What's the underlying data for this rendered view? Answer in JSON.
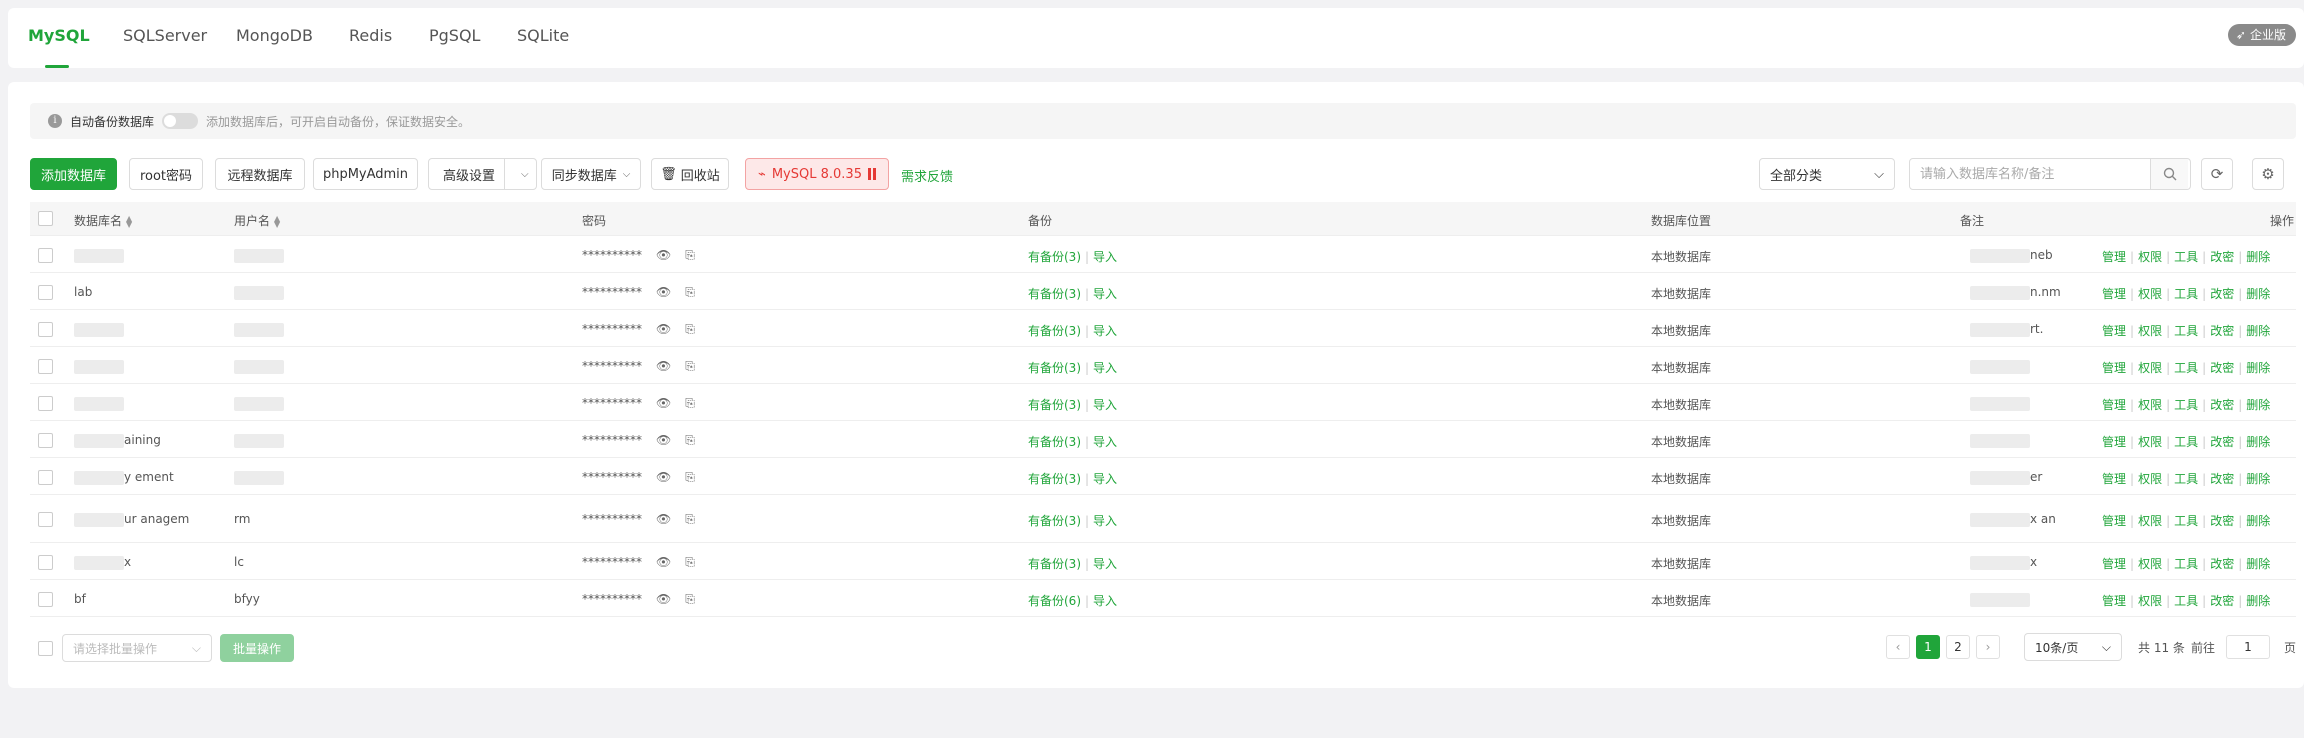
{
  "tabs": [
    "MySQL",
    "SQLServer",
    "MongoDB",
    "Redis",
    "PgSQL",
    "SQLite"
  ],
  "enterprise_badge": "企业版",
  "notice": {
    "label": "自动备份数据库",
    "hint": "添加数据库后，可开启自动备份，保证数据安全。"
  },
  "toolbar": {
    "add_db": "添加数据库",
    "root_password": "root密码",
    "remote_db": "远程数据库",
    "phpmyadmin": "phpMyAdmin",
    "advanced": "高级设置",
    "sync_db": "同步数据库",
    "recycle_bin": "回收站",
    "mysql_version": "MySQL 8.0.35",
    "feedback": "需求反馈",
    "category": "全部分类",
    "search_placeholder": "请输入数据库名称/备注"
  },
  "table": {
    "headers": {
      "db_name": "数据库名",
      "username": "用户名",
      "password": "密码",
      "backup": "备份",
      "location": "数据库位置",
      "note": "备注",
      "actions": "操作"
    },
    "rows": [
      {
        "db_name": "",
        "username": "",
        "password": "**********",
        "backup": "有备份(3)",
        "import": "导入",
        "location": "本地数据库",
        "note": "neb"
      },
      {
        "db_name": "lab",
        "username": "",
        "password": "**********",
        "backup": "有备份(3)",
        "import": "导入",
        "location": "本地数据库",
        "note": "n.nm"
      },
      {
        "db_name": "",
        "username": "",
        "password": "**********",
        "backup": "有备份(3)",
        "import": "导入",
        "location": "本地数据库",
        "note": "rt."
      },
      {
        "db_name": "",
        "username": "",
        "password": "**********",
        "backup": "有备份(3)",
        "import": "导入",
        "location": "本地数据库",
        "note": ""
      },
      {
        "db_name": "",
        "username": "",
        "password": "**********",
        "backup": "有备份(3)",
        "import": "导入",
        "location": "本地数据库",
        "note": ""
      },
      {
        "db_name": "aining",
        "username": "",
        "password": "**********",
        "backup": "有备份(3)",
        "import": "导入",
        "location": "本地数据库",
        "note": ""
      },
      {
        "db_name": "y ement",
        "username": "",
        "password": "**********",
        "backup": "有备份(3)",
        "import": "导入",
        "location": "本地数据库",
        "note": "er"
      },
      {
        "db_name": "ur anagem",
        "username": "rm",
        "password": "**********",
        "backup": "有备份(3)",
        "import": "导入",
        "location": "本地数据库",
        "note": "x an"
      },
      {
        "db_name": "x",
        "username": "lc",
        "password": "**********",
        "backup": "有备份(3)",
        "import": "导入",
        "location": "本地数据库",
        "note": "x"
      },
      {
        "db_name": "bf",
        "username": "bfyy",
        "password": "**********",
        "backup": "有备份(6)",
        "import": "导入",
        "location": "本地数据库",
        "note": ""
      }
    ],
    "row_actions": [
      "管理",
      "权限",
      "工具",
      "改密",
      "删除"
    ]
  },
  "footer": {
    "batch_placeholder": "请选择批量操作",
    "batch_button": "批量操作",
    "pages": [
      "1",
      "2"
    ],
    "current_page": "1",
    "page_size": "10条/页",
    "total": "共 11 条",
    "goto_label": "前往",
    "goto_value": "1",
    "page_suffix": "页"
  },
  "colors": {
    "accent": "#20a53a",
    "danger": "#e53935"
  }
}
